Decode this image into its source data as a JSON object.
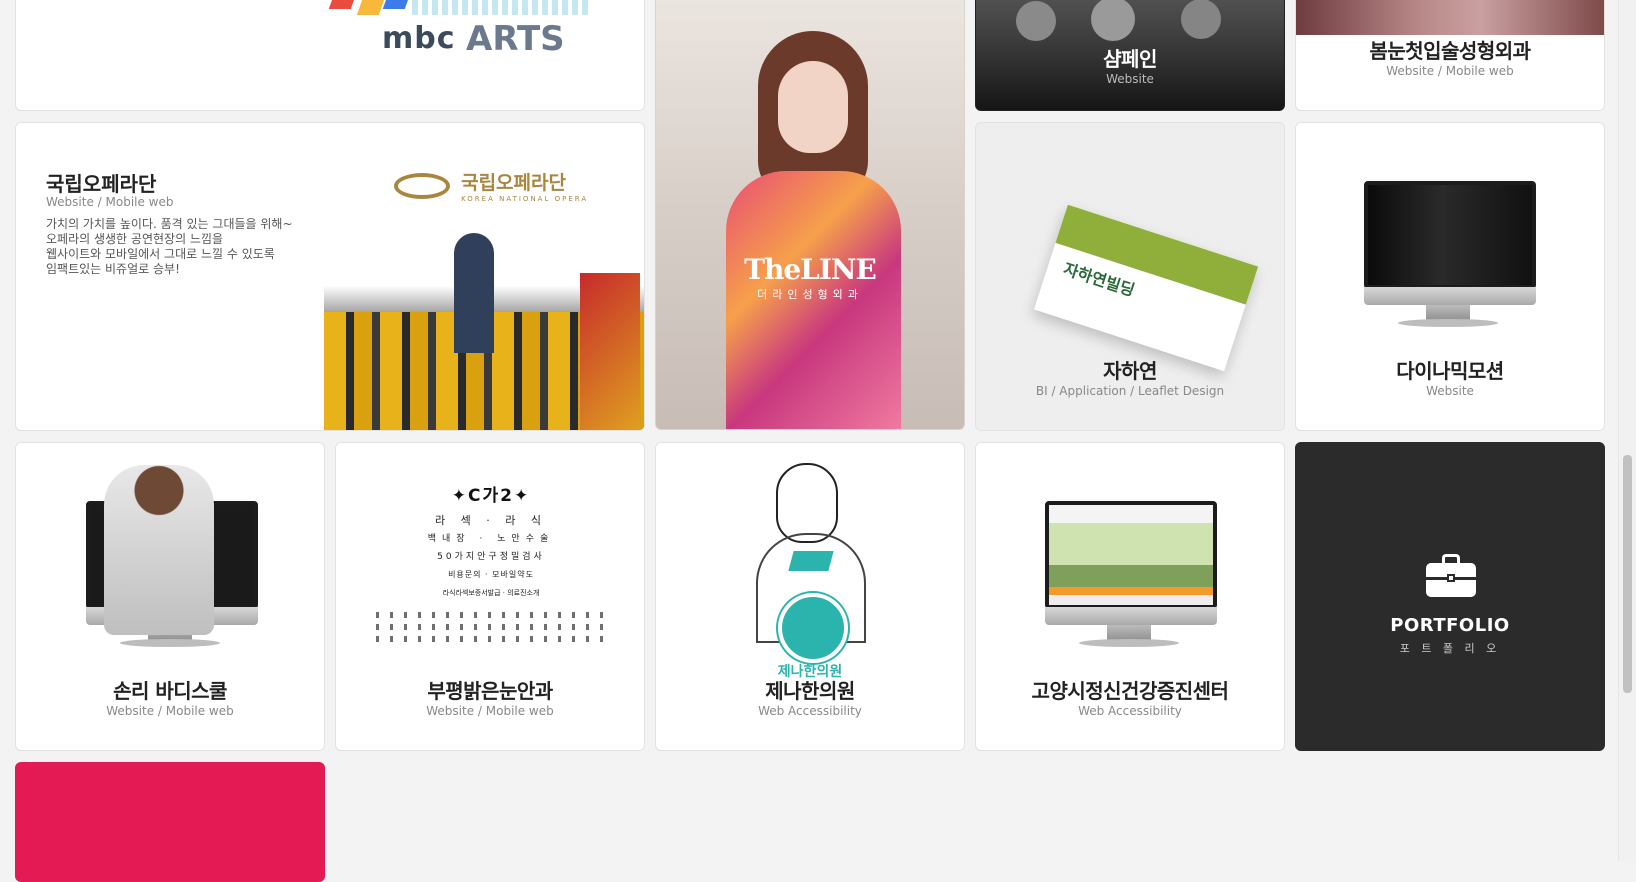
{
  "cards": {
    "mbc": {
      "logo_a": "mbc",
      "logo_b": "ARTS"
    },
    "samphein": {
      "title": "샴페인",
      "subtitle": "Website"
    },
    "bomnun": {
      "title": "봄눈첫입술성형외과",
      "subtitle": "Website / Mobile web"
    },
    "opera": {
      "title": "국립오페라단",
      "subtitle": "Website / Mobile web",
      "description": [
        "가치의 가치를 높이다. 품격 있는 그대들을 위해~",
        "오페라의 생생한 공연현장의 느낌을",
        "웹사이트와 모바일에서 그대로 느낄 수 있도록",
        "임팩트있는 비쥬얼로 승부!"
      ],
      "logo_ko": "국립오페라단",
      "logo_en": "KOREA NATIONAL OPERA"
    },
    "theline": {
      "logo": "TheLINE",
      "logo_sub": "더라인성형외과"
    },
    "jahayeon": {
      "title": "자하연",
      "subtitle": "BI / Application / Leaflet Design",
      "card_logo": "자하연빌딩"
    },
    "dynamic": {
      "title": "다이나믹모션",
      "subtitle": "Website"
    },
    "sonri": {
      "title": "손리 바디스쿨",
      "subtitle": "Website / Mobile web"
    },
    "bupyeong": {
      "title": "부평밝은눈안과",
      "subtitle": "Website / Mobile web",
      "chart_rows": [
        "라 섹 · 라 식",
        "백내장 · 노안수술",
        "50가지안구정밀검사",
        "비용문의 · 모바일약도",
        "라식라섹보증서발급 · 의료진소개"
      ]
    },
    "jena": {
      "title": "제나한의원",
      "subtitle": "Web Accessibility",
      "logo_text": "제나한의원"
    },
    "goyang": {
      "title": "고양시정신건강증진센터",
      "subtitle": "Web Accessibility"
    },
    "portfolio": {
      "title": "PORTFOLIO",
      "subtitle": "포 트 폴 리 오"
    }
  },
  "colors": {
    "background": "#f3f3f3",
    "portfolio_bg": "#2b2b2b",
    "pink": "#e31a53",
    "jena_teal": "#2bb3ae",
    "opera_gold": "#a8863e"
  }
}
